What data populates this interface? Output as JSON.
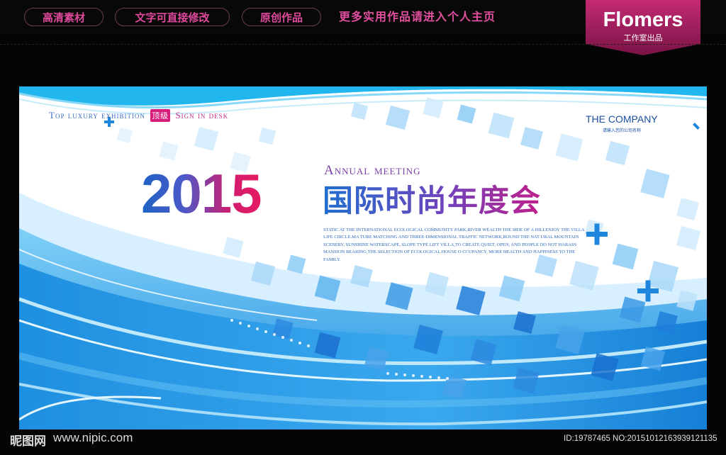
{
  "header": {
    "pills": [
      "高清素材",
      "文字可直接修改",
      "原创作品"
    ],
    "promo": "更多实用作品请进入个人主页",
    "brand_name": "Flomers",
    "brand_sub": "工作室出品"
  },
  "banner": {
    "tagline_a": "Top luxury exhibition",
    "tagline_badge": "顶级",
    "tagline_b": "Sign in desk",
    "company": "THE COMPANY",
    "company_sub": "请输入您的公司名称",
    "year": "2015",
    "annual": "Annual meeting",
    "annual_cn": "国际时尚年度会",
    "body_text": "STATIC AT THE INTERNATIONAL ECOLOGICAL COMMUNITY PARK,RIVER WEALTH THE SIDE OF A HILLENJOY THE VILLA LIFE CIRCLE.MA TURE MATCHING AND THREE-DIMENSIONAL TRAFFIC NETWORK,ROUND THE NAT URAL MOUNTAIN SCENERY, SUNSHINE WATERSCAPE, SLOPE TYPE LIFT VILLA,TO CREATE QUIET, OPEN, AND PEOPLE DO NOT HARASS MANSION BEARING,THE SELECTION OF ECOLOGICAL HOUSE O CCUPANCY, MORE HEALTH AND HAPPINESS TO THE FAMILY."
  },
  "watermark": {
    "logo_text": "昵图网",
    "url": "www.nipic.com",
    "id_text": "ID:19787465 NO:20151012163939121135"
  },
  "colors": {
    "accent_pink": "#e0509f",
    "brand_bg": "#9d1b5a",
    "banner_blue": "#1f8fe0"
  }
}
